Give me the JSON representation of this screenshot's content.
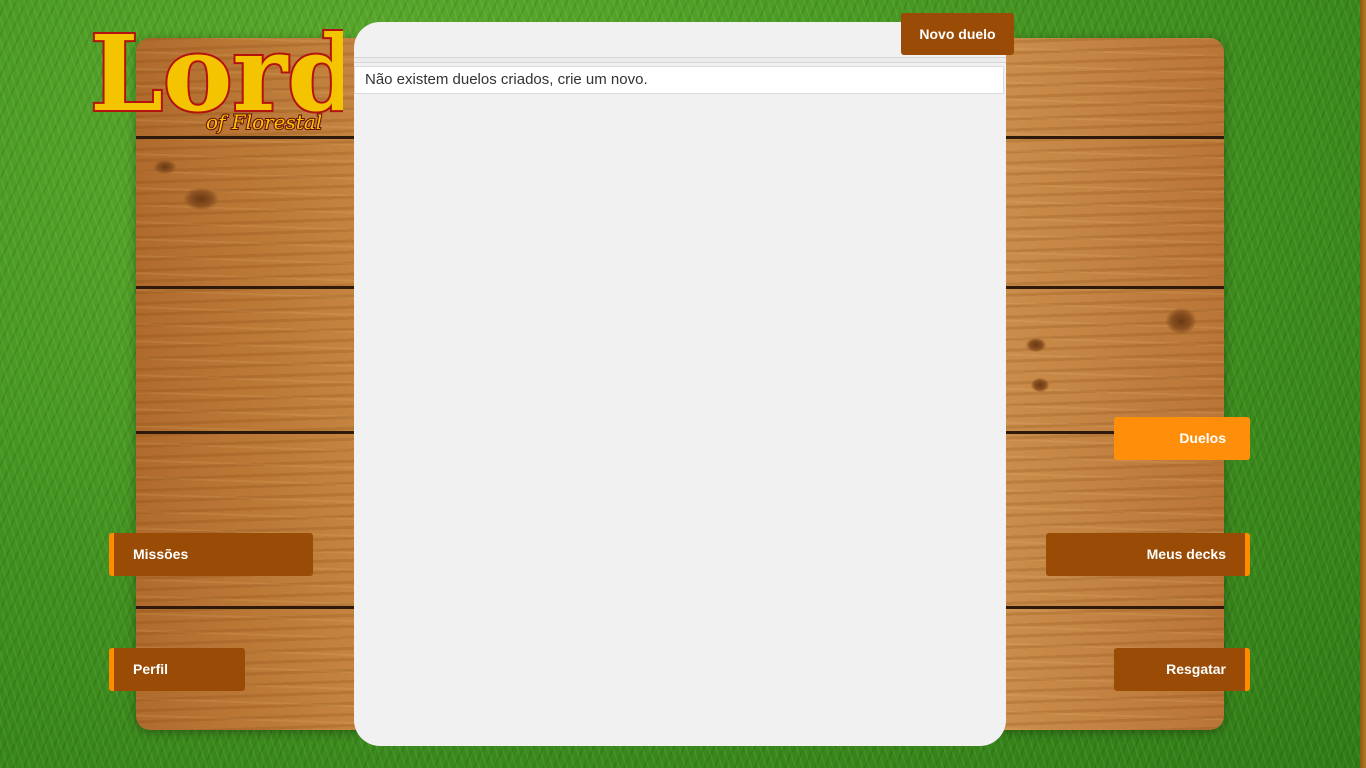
{
  "logo": {
    "title": "Lord",
    "subtitle": "of Florestal"
  },
  "panel": {
    "new_duel_label": "Novo duelo",
    "empty_message": "Não existem duelos criados, crie um novo."
  },
  "nav": {
    "left": [
      {
        "label": "Missões"
      },
      {
        "label": "Perfil"
      }
    ],
    "right": [
      {
        "label": "Duelos",
        "active": true
      },
      {
        "label": "Meus decks"
      },
      {
        "label": "Resgatar"
      }
    ]
  },
  "colors": {
    "button": "#9a4c06",
    "accent": "#ff8c00",
    "active": "#ff8e0a",
    "panel": "#f1f1f1",
    "logo_fill": "#f5c400",
    "logo_stroke": "#b3120e"
  }
}
